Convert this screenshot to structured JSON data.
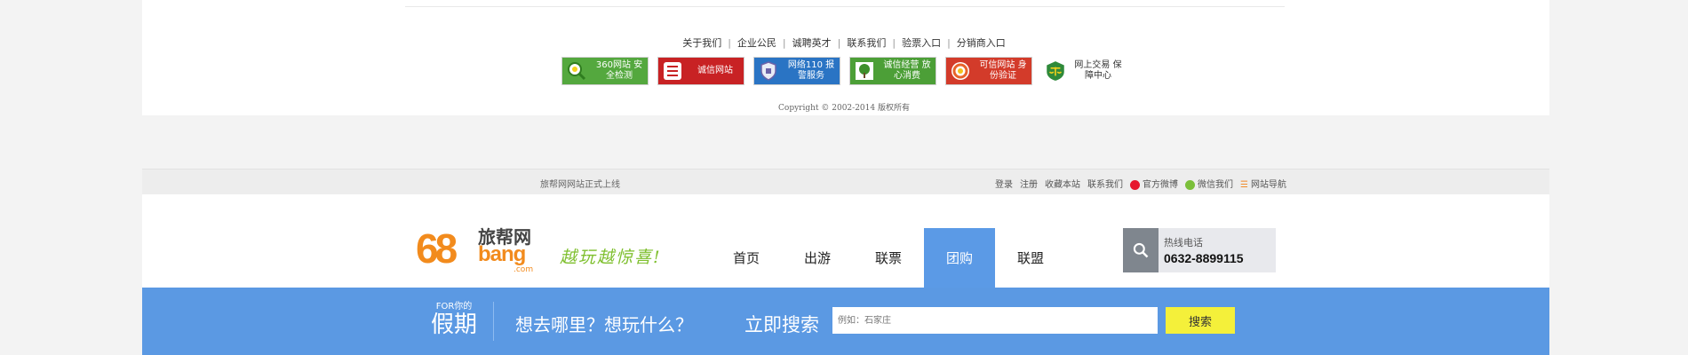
{
  "footer": {
    "links": [
      "关于我们",
      "企业公民",
      "诚聘英才",
      "联系我们",
      "验票入口",
      "分销商入口"
    ],
    "badges": [
      {
        "icon": "magnifier-icon",
        "text": "360网站 安全检测",
        "color": "#54a83e"
      },
      {
        "icon": "xin-icon",
        "text": "诚信网站",
        "color": "#c82224"
      },
      {
        "icon": "shield-icon",
        "text": "网络110 报警服务",
        "color": "#2a74c4"
      },
      {
        "icon": "tree-icon",
        "text": "诚信经营 放心消费",
        "color": "#4c9f37"
      },
      {
        "icon": "trust-ring-icon",
        "text": "可信网站 身份验证",
        "color": "#d33b2a"
      },
      {
        "icon": "scales-icon",
        "text": "网上交易 保障中心",
        "color": "#ffffff"
      }
    ],
    "copyright": "Copyright © 2002-2014 版权所有"
  },
  "topbar": {
    "notice": "旅帮网网站正式上线",
    "links": {
      "login": "登录",
      "register": "注册",
      "favorite": "收藏本站",
      "contact": "联系我们",
      "weibo": "官方微博",
      "wechat": "微信我们",
      "sitemap": "网站导航"
    }
  },
  "header": {
    "logo": {
      "number": "68",
      "cn": "旅帮网",
      "bang": "bang",
      "com": ".com"
    },
    "slogan": "越玩越惊喜!",
    "nav": [
      {
        "label": "首页",
        "active": false
      },
      {
        "label": "出游",
        "active": false
      },
      {
        "label": "联票",
        "active": false
      },
      {
        "label": "团购",
        "active": true
      },
      {
        "label": "联盟",
        "active": false
      }
    ],
    "hotline": {
      "label": "热线电话",
      "number": "0632-8899115"
    }
  },
  "search_band": {
    "for_small": "FOR你的",
    "for_big": "假期",
    "question": "想去哪里？想玩什么？",
    "search_now": "立即搜索",
    "placeholder": "例如：石家庄",
    "button": "搜索"
  },
  "colors": {
    "accent_blue": "#5b99e3",
    "brand_orange": "#f28b1d",
    "slogan_green": "#7ebf2d",
    "search_button": "#f4f03a"
  }
}
